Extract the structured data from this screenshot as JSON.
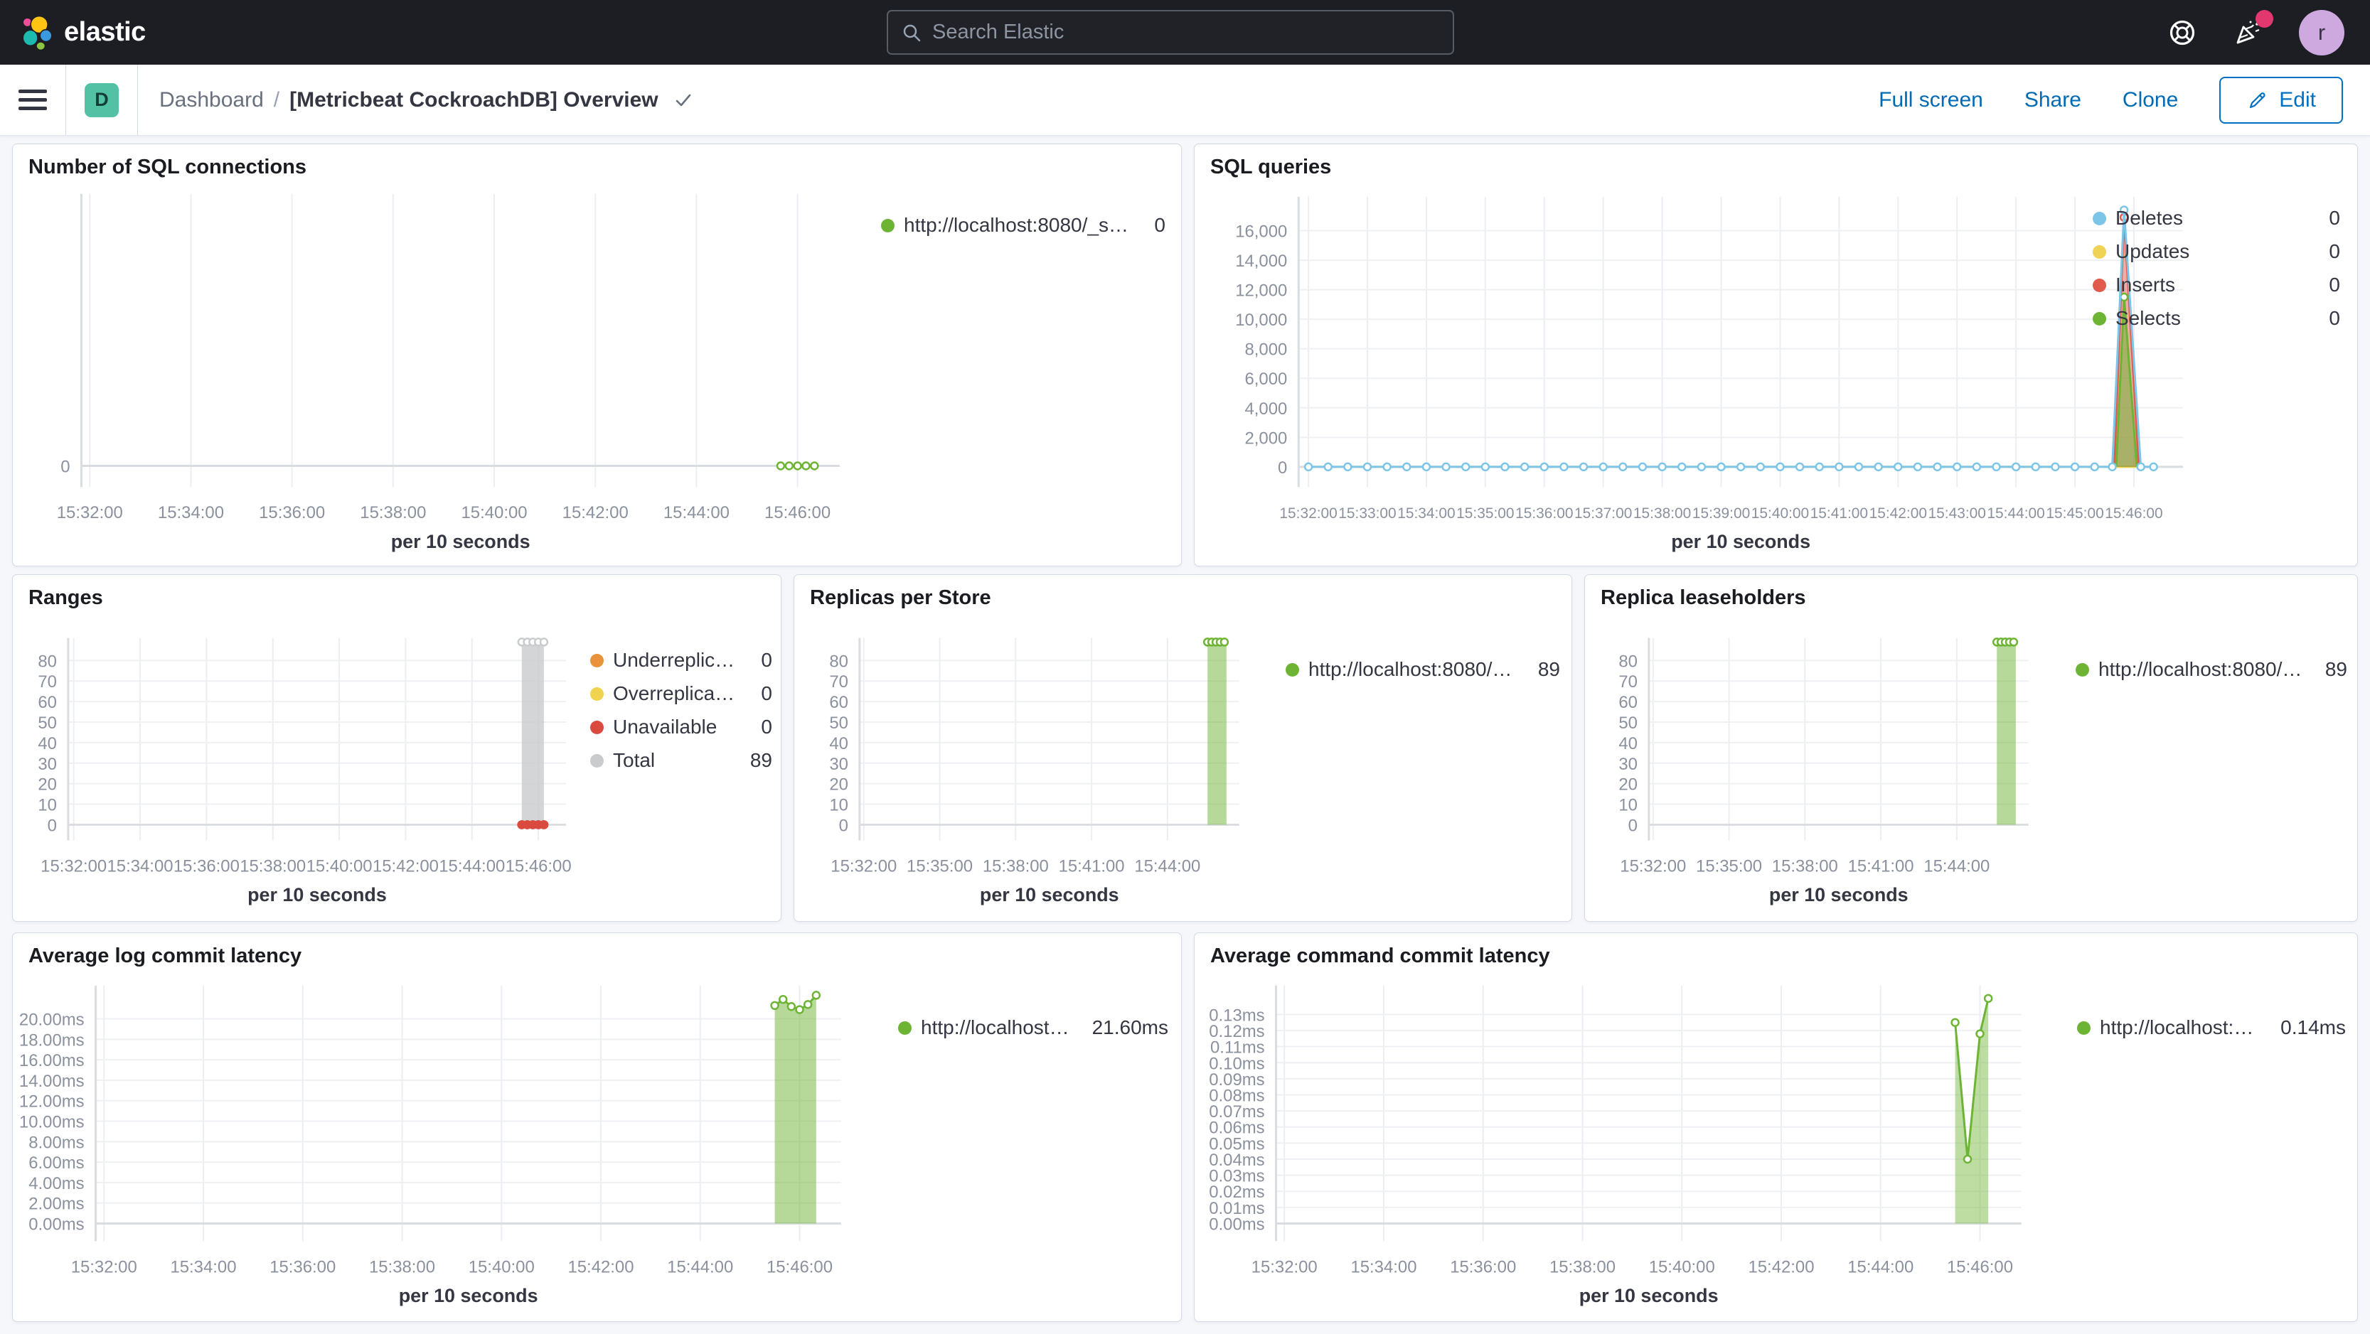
{
  "header": {
    "brand": "elastic",
    "search_placeholder": "Search Elastic",
    "avatar_initial": "r"
  },
  "nav": {
    "space_initial": "D",
    "breadcrumb_root": "Dashboard",
    "breadcrumb_sep": "/",
    "title": "[Metricbeat CockroachDB] Overview",
    "actions": [
      "Full screen",
      "Share",
      "Clone"
    ],
    "edit_label": "Edit"
  },
  "colors": {
    "header_bg": "#1d1e24",
    "link": "#006bb4",
    "edit": "#0071c2",
    "badge": "#53c1a3",
    "avatar_bg": "#cda9e0",
    "notify": "#e2386f"
  },
  "chart_data": [
    {
      "id": "sql-connections",
      "type": "line",
      "title": "Number of SQL connections",
      "x_axis_label": "per 10 seconds",
      "x_domain": [
        "15:31:50",
        "15:46:50"
      ],
      "x_ticks": [
        "15:32:00",
        "15:34:00",
        "15:36:00",
        "15:38:00",
        "15:40:00",
        "15:42:00",
        "15:44:00",
        "15:46:00"
      ],
      "y_ticks": [
        {
          "v": 0,
          "label": "0"
        }
      ],
      "ylim": [
        -0.5,
        12
      ],
      "series": [
        {
          "name": "http://localhost:8080/_stat...",
          "type": "line",
          "color": "#6DB434",
          "flat": {
            "from": "15:45:40",
            "to": "15:46:20",
            "step_seconds": 10,
            "value": 0
          },
          "markers": "all"
        }
      ],
      "legend": [
        {
          "label": "http://localhost:8080/_stat...",
          "value": "0",
          "color": "#6DB434"
        }
      ]
    },
    {
      "id": "sql-queries",
      "type": "area",
      "title": "SQL queries",
      "x_axis_label": "per 10 seconds",
      "x_domain": [
        "15:31:50",
        "15:46:50"
      ],
      "x_ticks": [
        "15:32:00",
        "15:33:00",
        "15:34:00",
        "15:35:00",
        "15:36:00",
        "15:37:00",
        "15:38:00",
        "15:39:00",
        "15:40:00",
        "15:41:00",
        "15:42:00",
        "15:43:00",
        "15:44:00",
        "15:45:00",
        "15:46:00"
      ],
      "y_ticks": [
        {
          "v": 0,
          "label": "0"
        },
        {
          "v": 2000,
          "label": "2,000"
        },
        {
          "v": 4000,
          "label": "4,000"
        },
        {
          "v": 6000,
          "label": "6,000"
        },
        {
          "v": 8000,
          "label": "8,000"
        },
        {
          "v": 10000,
          "label": "10,000"
        },
        {
          "v": 12000,
          "label": "12,000"
        },
        {
          "v": 14000,
          "label": "14,000"
        },
        {
          "v": 16000,
          "label": "16,000"
        }
      ],
      "ylim": [
        -700,
        18300
      ],
      "series": [
        {
          "name": "Updates",
          "type": "line",
          "color": "#EFD354",
          "flat": {
            "from": "15:32:00",
            "to": "15:46:30",
            "step_seconds": 20,
            "value": 0
          }
        },
        {
          "name": "Inserts",
          "type": "area",
          "color": "#E05B4C",
          "fill_opacity": 0.5,
          "points": [
            [
              "15:45:40",
              0
            ],
            [
              "15:45:50",
              16900
            ],
            [
              "15:46:05",
              0
            ]
          ],
          "markers": [
            [
              "15:45:50",
              16900
            ]
          ]
        },
        {
          "name": "Selects",
          "type": "area",
          "color": "#6DB434",
          "fill_opacity": 0.55,
          "points": [
            [
              "15:45:42",
              0
            ],
            [
              "15:45:50",
              11500
            ],
            [
              "15:46:03",
              0
            ]
          ],
          "markers": [
            [
              "15:45:50",
              11500
            ]
          ]
        },
        {
          "name": "Deletes",
          "type": "line",
          "color": "#7DC5E8",
          "flat": {
            "from": "15:32:00",
            "to": "15:46:30",
            "step_seconds": 20,
            "value": 0
          },
          "points": [
            [
              "15:45:38",
              0
            ],
            [
              "15:45:50",
              17400
            ],
            [
              "15:46:07",
              0
            ]
          ],
          "markers": "all"
        }
      ],
      "legend": [
        {
          "label": "Deletes",
          "value": "0",
          "color": "#7DC5E8"
        },
        {
          "label": "Updates",
          "value": "0",
          "color": "#EFD354"
        },
        {
          "label": "Inserts",
          "value": "0",
          "color": "#E05B4C"
        },
        {
          "label": "Selects",
          "value": "0",
          "color": "#6DB434"
        }
      ]
    },
    {
      "id": "ranges",
      "type": "area",
      "title": "Ranges",
      "x_axis_label": "per 10 seconds",
      "x_domain": [
        "15:31:50",
        "15:46:50"
      ],
      "x_ticks": [
        "15:32:00",
        "15:34:00",
        "15:36:00",
        "15:38:00",
        "15:40:00",
        "15:42:00",
        "15:44:00",
        "15:46:00"
      ],
      "y_ticks": [
        {
          "v": 0,
          "label": "0"
        },
        {
          "v": 10,
          "label": "10"
        },
        {
          "v": 20,
          "label": "20"
        },
        {
          "v": 30,
          "label": "30"
        },
        {
          "v": 40,
          "label": "40"
        },
        {
          "v": 50,
          "label": "50"
        },
        {
          "v": 60,
          "label": "60"
        },
        {
          "v": 70,
          "label": "70"
        },
        {
          "v": 80,
          "label": "80"
        }
      ],
      "ylim": [
        -2.8,
        91
      ],
      "series": [
        {
          "name": "Total",
          "type": "band",
          "color": "#C9CBCD",
          "fill_opacity": 0.8,
          "x0": "15:45:30",
          "x1": "15:46:10",
          "value": 89,
          "top_marker_step_seconds": 10
        },
        {
          "name": "Unavailable",
          "type": "dots",
          "color": "#DB4A3F",
          "points": [
            [
              "15:45:30",
              0
            ],
            [
              "15:45:40",
              0
            ],
            [
              "15:45:50",
              0
            ],
            [
              "15:46:00",
              0
            ],
            [
              "15:46:10",
              0
            ]
          ]
        }
      ],
      "legend": [
        {
          "label": "Underreplicated",
          "value": "0",
          "color": "#E8923B"
        },
        {
          "label": "Overreplicated",
          "value": "0",
          "color": "#F0D34E"
        },
        {
          "label": "Unavailable",
          "value": "0",
          "color": "#DB4A3F"
        },
        {
          "label": "Total",
          "value": "89",
          "color": "#C9CBCD"
        }
      ]
    },
    {
      "id": "replicas-per-store",
      "type": "area",
      "title": "Replicas per Store",
      "x_axis_label": "per 10 seconds",
      "x_domain": [
        "15:31:50",
        "15:46:50"
      ],
      "x_ticks": [
        "15:32:00",
        "15:35:00",
        "15:38:00",
        "15:41:00",
        "15:44:00"
      ],
      "y_ticks": [
        {
          "v": 0,
          "label": "0"
        },
        {
          "v": 10,
          "label": "10"
        },
        {
          "v": 20,
          "label": "20"
        },
        {
          "v": 30,
          "label": "30"
        },
        {
          "v": 40,
          "label": "40"
        },
        {
          "v": 50,
          "label": "50"
        },
        {
          "v": 60,
          "label": "60"
        },
        {
          "v": 70,
          "label": "70"
        },
        {
          "v": 80,
          "label": "80"
        }
      ],
      "ylim": [
        -2.8,
        91
      ],
      "series": [
        {
          "name": "http://localhost:8080/_sta...",
          "type": "band",
          "color": "#6DB434",
          "fill_opacity": 0.5,
          "x0": "15:45:35",
          "x1": "15:46:20",
          "value": 89,
          "top_marker_step_seconds": 10
        }
      ],
      "legend": [
        {
          "label": "http://localhost:8080/_sta...",
          "value": "89",
          "color": "#6DB434"
        }
      ]
    },
    {
      "id": "replica-leaseholders",
      "type": "area",
      "title": "Replica leaseholders",
      "x_axis_label": "per 10 seconds",
      "x_domain": [
        "15:31:50",
        "15:46:50"
      ],
      "x_ticks": [
        "15:32:00",
        "15:35:00",
        "15:38:00",
        "15:41:00",
        "15:44:00"
      ],
      "y_ticks": [
        {
          "v": 0,
          "label": "0"
        },
        {
          "v": 10,
          "label": "10"
        },
        {
          "v": 20,
          "label": "20"
        },
        {
          "v": 30,
          "label": "30"
        },
        {
          "v": 40,
          "label": "40"
        },
        {
          "v": 50,
          "label": "50"
        },
        {
          "v": 60,
          "label": "60"
        },
        {
          "v": 70,
          "label": "70"
        },
        {
          "v": 80,
          "label": "80"
        }
      ],
      "ylim": [
        -2.8,
        91
      ],
      "series": [
        {
          "name": "http://localhost:8080/_sta...",
          "type": "band",
          "color": "#6DB434",
          "fill_opacity": 0.5,
          "x0": "15:45:35",
          "x1": "15:46:20",
          "value": 89,
          "top_marker_step_seconds": 10
        }
      ],
      "legend": [
        {
          "label": "http://localhost:8080/_sta...",
          "value": "89",
          "color": "#6DB434"
        }
      ]
    },
    {
      "id": "avg-log-commit-latency",
      "type": "area",
      "title": "Average log commit latency",
      "x_axis_label": "per 10 seconds",
      "x_domain": [
        "15:31:50",
        "15:46:50"
      ],
      "x_ticks": [
        "15:32:00",
        "15:34:00",
        "15:36:00",
        "15:38:00",
        "15:40:00",
        "15:42:00",
        "15:44:00",
        "15:46:00"
      ],
      "y_ticks": [
        {
          "v": 0,
          "label": "0.00ms"
        },
        {
          "v": 2,
          "label": "2.00ms"
        },
        {
          "v": 4,
          "label": "4.00ms"
        },
        {
          "v": 6,
          "label": "6.00ms"
        },
        {
          "v": 8,
          "label": "8.00ms"
        },
        {
          "v": 10,
          "label": "10.00ms"
        },
        {
          "v": 12,
          "label": "12.00ms"
        },
        {
          "v": 14,
          "label": "14.00ms"
        },
        {
          "v": 16,
          "label": "16.00ms"
        },
        {
          "v": 18,
          "label": "18.00ms"
        },
        {
          "v": 20,
          "label": "20.00ms"
        }
      ],
      "ylim": [
        -0.76,
        23.25
      ],
      "series": [
        {
          "name": "http://localhost:808...",
          "type": "area",
          "color": "#6DB434",
          "fill_opacity": 0.5,
          "points": [
            [
              "15:45:30",
              21.3
            ],
            [
              "15:45:40",
              21.9
            ],
            [
              "15:45:50",
              21.2
            ],
            [
              "15:46:00",
              20.9
            ],
            [
              "15:46:10",
              21.4
            ],
            [
              "15:46:20",
              22.3
            ]
          ],
          "markers": "all"
        }
      ],
      "legend": [
        {
          "label": "http://localhost:808...",
          "value": "21.60ms",
          "color": "#6DB434"
        }
      ]
    },
    {
      "id": "avg-command-commit-latency",
      "type": "area",
      "title": "Average command commit latency",
      "x_axis_label": "per 10 seconds",
      "x_domain": [
        "15:31:50",
        "15:46:50"
      ],
      "x_ticks": [
        "15:32:00",
        "15:34:00",
        "15:36:00",
        "15:38:00",
        "15:40:00",
        "15:42:00",
        "15:44:00",
        "15:46:00"
      ],
      "y_ticks": [
        {
          "v": 0,
          "label": "0.00ms"
        },
        {
          "v": 0.01,
          "label": "0.01ms"
        },
        {
          "v": 0.02,
          "label": "0.02ms"
        },
        {
          "v": 0.03,
          "label": "0.03ms"
        },
        {
          "v": 0.04,
          "label": "0.04ms"
        },
        {
          "v": 0.05,
          "label": "0.05ms"
        },
        {
          "v": 0.06,
          "label": "0.06ms"
        },
        {
          "v": 0.07,
          "label": "0.07ms"
        },
        {
          "v": 0.08,
          "label": "0.08ms"
        },
        {
          "v": 0.09,
          "label": "0.09ms"
        },
        {
          "v": 0.1,
          "label": "0.10ms"
        },
        {
          "v": 0.11,
          "label": "0.11ms"
        },
        {
          "v": 0.12,
          "label": "0.12ms"
        },
        {
          "v": 0.13,
          "label": "0.13ms"
        }
      ],
      "ylim": [
        -0.00485,
        0.148
      ],
      "series": [
        {
          "name": "http://localhost:8080...",
          "type": "area",
          "color": "#6DB434",
          "fill_opacity": 0.45,
          "points": [
            [
              "15:45:30",
              0.125
            ],
            [
              "15:45:45",
              0.04
            ],
            [
              "15:46:00",
              0.118
            ],
            [
              "15:46:10",
              0.14
            ]
          ],
          "markers": "all"
        }
      ],
      "legend": [
        {
          "label": "http://localhost:8080...",
          "value": "0.14ms",
          "color": "#6DB434"
        }
      ]
    }
  ]
}
